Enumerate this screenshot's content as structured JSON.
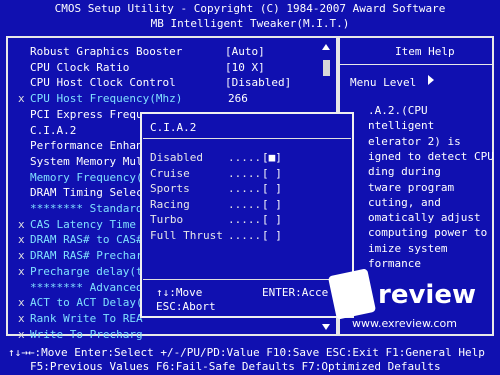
{
  "header": {
    "line1": "CMOS Setup Utility - Copyright (C) 1984-2007 Award Software",
    "line2": "MB Intelligent Tweaker(M.I.T.)"
  },
  "menu": [
    {
      "mark": "",
      "label": "Robust Graphics Booster",
      "value": "[Auto]",
      "color": "white"
    },
    {
      "mark": "",
      "label": "CPU Clock Ratio",
      "value": "[10 X]",
      "color": "white"
    },
    {
      "mark": "",
      "label": "CPU Host Clock Control",
      "value": "[Disabled]",
      "color": "white"
    },
    {
      "mark": "x",
      "label": "CPU Host Frequency(Mhz)",
      "value": "266",
      "color": "cyan"
    },
    {
      "mark": "",
      "label": "PCI Express Frequ",
      "value": "",
      "color": "white"
    },
    {
      "mark": "",
      "label": "C.I.A.2",
      "value": "",
      "color": "white"
    },
    {
      "mark": "",
      "label": "Performance Enhan",
      "value": "",
      "color": "white"
    },
    {
      "mark": "",
      "label": "System Memory Mul",
      "value": "",
      "color": "white"
    },
    {
      "mark": "",
      "label": "Memory Frequency(",
      "value": "",
      "color": "cyan"
    },
    {
      "mark": "",
      "label": "DRAM Timing Selec",
      "value": "",
      "color": "white"
    },
    {
      "mark": "",
      "label": "******** Standard",
      "value": "",
      "color": "cyan"
    },
    {
      "mark": "x",
      "label": "CAS Latency Time",
      "value": "",
      "color": "cyan"
    },
    {
      "mark": "x",
      "label": "DRAM RAS# to CAS#",
      "value": "",
      "color": "cyan"
    },
    {
      "mark": "x",
      "label": "DRAM RAS# Prechar",
      "value": "",
      "color": "cyan"
    },
    {
      "mark": "x",
      "label": "Precharge delay(t",
      "value": "",
      "color": "cyan"
    },
    {
      "mark": "",
      "label": "******** Advanced",
      "value": "",
      "color": "cyan"
    },
    {
      "mark": "x",
      "label": "ACT to ACT Delay(",
      "value": "",
      "color": "cyan"
    },
    {
      "mark": "x",
      "label": "Rank Write To REA",
      "value": "",
      "color": "cyan"
    },
    {
      "mark": "x",
      "label": "Write To Precharg",
      "value": "",
      "color": "cyan"
    }
  ],
  "help": {
    "title": "Item Help",
    "menu_level": "Menu Level",
    "lines": [
      ".A.2.(CPU",
      "ntelligent",
      "elerator 2) is",
      "igned to detect CPU",
      "ding during",
      "tware program",
      "cuting, and",
      "omatically adjust",
      "computing power to",
      "imize system",
      "formance"
    ]
  },
  "popup": {
    "title": "C.I.A.2",
    "dots": ".....",
    "options": [
      {
        "label": "Disabled",
        "box": "[■]"
      },
      {
        "label": "Cruise",
        "box": "[ ]"
      },
      {
        "label": "Sports",
        "box": "[ ]"
      },
      {
        "label": "Racing",
        "box": "[ ]"
      },
      {
        "label": "Turbo",
        "box": "[ ]"
      },
      {
        "label": "Full Thrust",
        "box": "[ ]"
      }
    ],
    "keys": {
      "move": "↑↓:Move",
      "enter": "ENTER:Acce",
      "abort": "ESC:Abort"
    }
  },
  "footer": {
    "line1": "↑↓→←:Move  Enter:Select  +/-/PU/PD:Value  F10:Save  ESC:Exit  F1:General Help",
    "line2": "F5:Previous Values  F6:Fail-Safe Defaults  F7:Optimized Defaults"
  },
  "watermark": {
    "brand": "review",
    "url": "www.exreview.com"
  },
  "colors": {
    "background": "#1010b0",
    "cyan_text": "#80e0ff",
    "white_text": "#ffffff"
  }
}
